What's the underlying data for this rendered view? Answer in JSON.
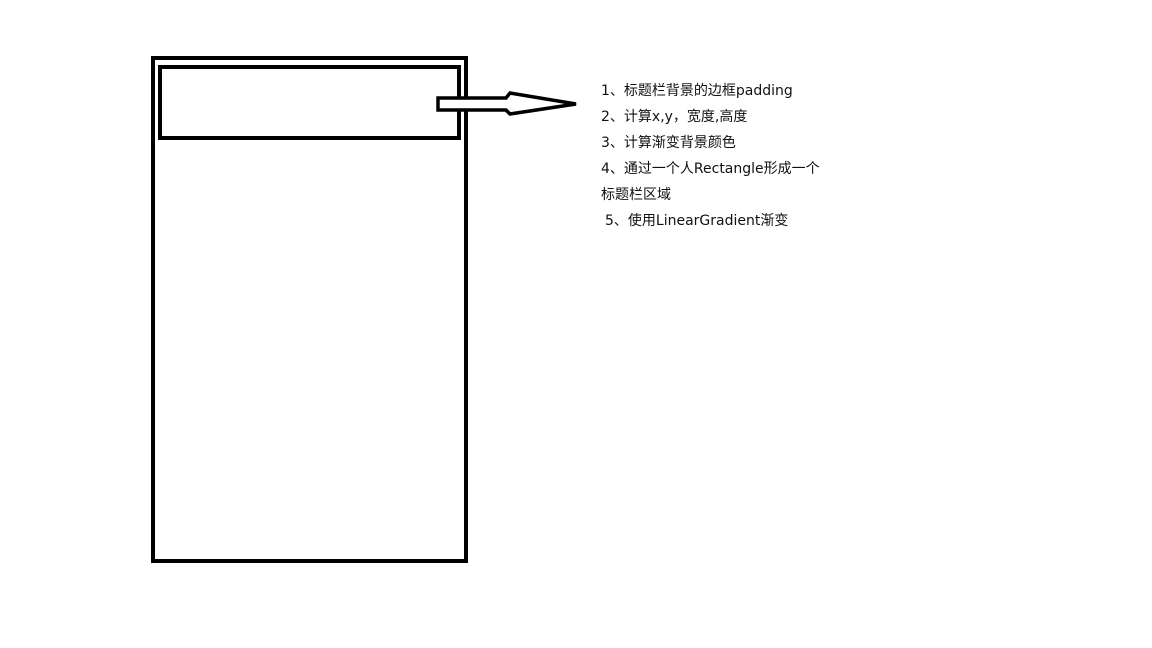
{
  "notes": {
    "line1": "1、标题栏背景的边框padding",
    "line2": "2、计算x,y，宽度,高度",
    "line3": "3、计算渐变背景颜色",
    "line4": "4、通过一个人Rectangle形成一个",
    "line5": "标题栏区域",
    "line6": " 5、使用LinearGradient渐变"
  },
  "colors": {
    "stroke": "#000000",
    "background": "#ffffff"
  }
}
